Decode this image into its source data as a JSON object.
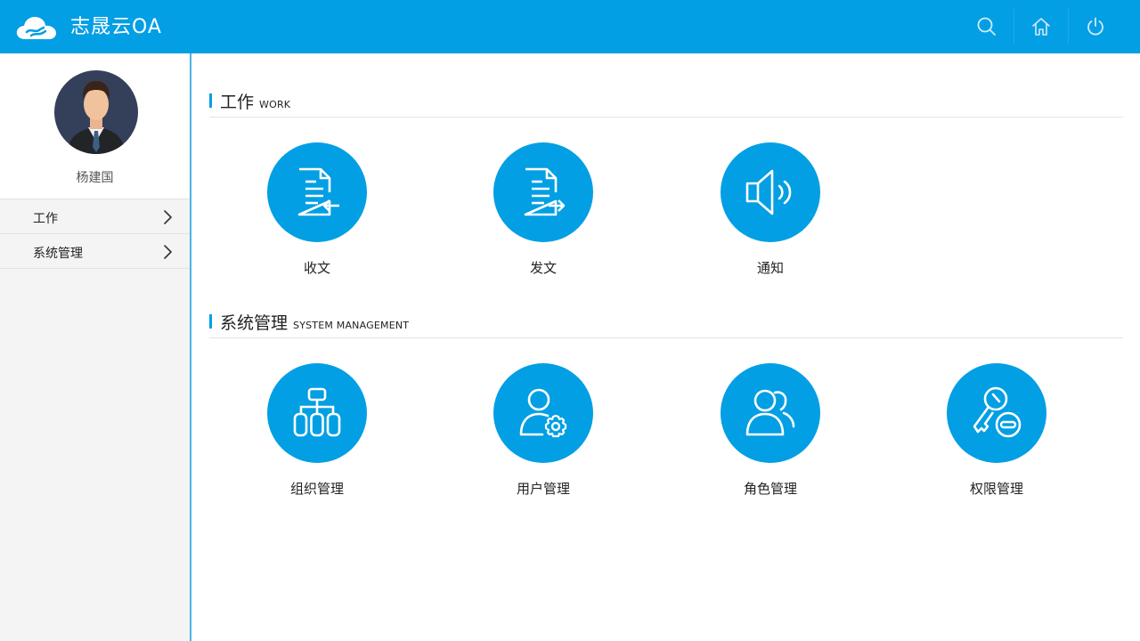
{
  "header": {
    "app_title": "志晟云OA",
    "actions": [
      {
        "icon": "search-icon"
      },
      {
        "icon": "home-icon"
      },
      {
        "icon": "power-icon"
      }
    ]
  },
  "colors": {
    "primary": "#039fe4",
    "sidebar_bg": "#f4f4f4",
    "sidebar_border": "#4bb4e6"
  },
  "sidebar": {
    "user_name": "杨建国",
    "items": [
      {
        "label": "工作"
      },
      {
        "label": "系统管理"
      }
    ]
  },
  "main": {
    "sections": [
      {
        "title": "工作",
        "subtitle": "WORK",
        "tiles": [
          {
            "label": "收文",
            "icon": "document-receive-icon"
          },
          {
            "label": "发文",
            "icon": "document-send-icon"
          },
          {
            "label": "通知",
            "icon": "speaker-icon"
          }
        ]
      },
      {
        "title": "系统管理",
        "subtitle": "SYSTEM MANAGEMENT",
        "tiles": [
          {
            "label": "组织管理",
            "icon": "org-chart-icon"
          },
          {
            "label": "用户管理",
            "icon": "user-settings-icon"
          },
          {
            "label": "角色管理",
            "icon": "users-group-icon"
          },
          {
            "label": "权限管理",
            "icon": "key-permission-icon"
          }
        ]
      }
    ]
  }
}
